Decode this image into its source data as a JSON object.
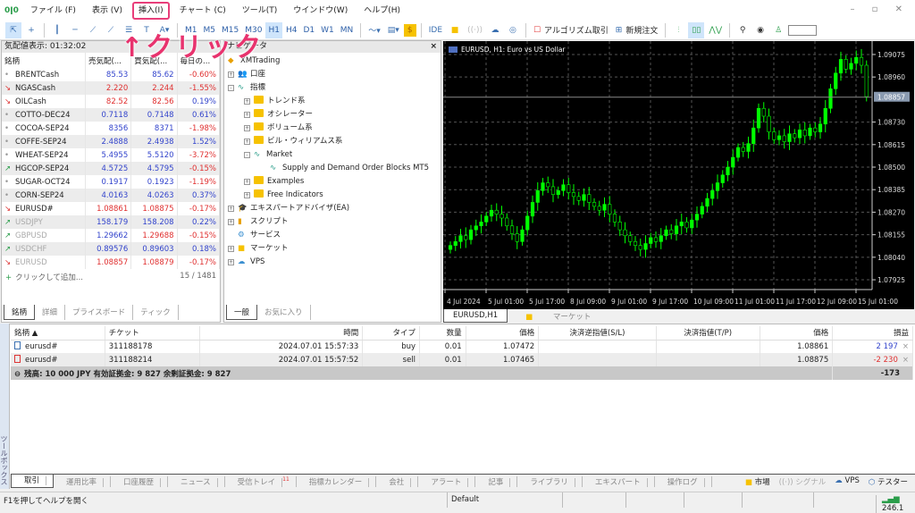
{
  "menu": {
    "items": [
      "ファイル (F)",
      "表示 (V)",
      "挿入(I)",
      "チャート (C)",
      "ツール(T)",
      "ウインドウ(W)",
      "ヘルプ(H)"
    ],
    "window_controls": "– ▫ ✕"
  },
  "toolbar": {
    "timeframes": [
      "M1",
      "M5",
      "M15",
      "M30",
      "H1",
      "H4",
      "D1",
      "W1",
      "MN"
    ],
    "active_timeframe": "H1",
    "ide": "IDE",
    "algo_trading": "アルゴリズム取引",
    "new_order": "新規注文"
  },
  "annotation": "↑クリック",
  "market_watch": {
    "title": "気配値表示: 01:32:02",
    "columns": [
      "銘柄",
      "売気配(...",
      "買気配(...",
      "毎日の..."
    ],
    "rows": [
      {
        "dir": "dot",
        "symbol": "BRENTCash",
        "bid": "85.53",
        "ask": "85.62",
        "change": "-0.60%",
        "bc": "blue",
        "ac": "blue",
        "cc": "red",
        "dim": false
      },
      {
        "dir": "down",
        "symbol": "NGASCash",
        "bid": "2.220",
        "ask": "2.244",
        "change": "-1.55%",
        "bc": "red",
        "ac": "red",
        "cc": "red",
        "dim": false
      },
      {
        "dir": "down",
        "symbol": "OILCash",
        "bid": "82.52",
        "ask": "82.56",
        "change": "0.19%",
        "bc": "red",
        "ac": "red",
        "cc": "blue",
        "dim": false
      },
      {
        "dir": "dot",
        "symbol": "COTTO-DEC24",
        "bid": "0.7118",
        "ask": "0.7148",
        "change": "0.61%",
        "bc": "blue",
        "ac": "blue",
        "cc": "blue",
        "dim": false
      },
      {
        "dir": "dot",
        "symbol": "COCOA-SEP24",
        "bid": "8356",
        "ask": "8371",
        "change": "-1.98%",
        "bc": "blue",
        "ac": "blue",
        "cc": "red",
        "dim": false
      },
      {
        "dir": "dot",
        "symbol": "COFFE-SEP24",
        "bid": "2.4888",
        "ask": "2.4938",
        "change": "1.52%",
        "bc": "blue",
        "ac": "blue",
        "cc": "blue",
        "dim": false
      },
      {
        "dir": "dot",
        "symbol": "WHEAT-SEP24",
        "bid": "5.4955",
        "ask": "5.5120",
        "change": "-3.72%",
        "bc": "blue",
        "ac": "blue",
        "cc": "red",
        "dim": false
      },
      {
        "dir": "up",
        "symbol": "HGCOP-SEP24",
        "bid": "4.5725",
        "ask": "4.5795",
        "change": "-0.15%",
        "bc": "blue",
        "ac": "blue",
        "cc": "red",
        "dim": false
      },
      {
        "dir": "dot",
        "symbol": "SUGAR-OCT24",
        "bid": "0.1917",
        "ask": "0.1923",
        "change": "-1.19%",
        "bc": "blue",
        "ac": "blue",
        "cc": "red",
        "dim": false
      },
      {
        "dir": "dot",
        "symbol": "CORN-SEP24",
        "bid": "4.0163",
        "ask": "4.0263",
        "change": "0.37%",
        "bc": "blue",
        "ac": "blue",
        "cc": "blue",
        "dim": false
      },
      {
        "dir": "down",
        "symbol": "EURUSD#",
        "bid": "1.08861",
        "ask": "1.08875",
        "change": "-0.17%",
        "bc": "red",
        "ac": "red",
        "cc": "red",
        "dim": false
      },
      {
        "dir": "up",
        "symbol": "USDJPY",
        "bid": "158.179",
        "ask": "158.208",
        "change": "0.22%",
        "bc": "blue",
        "ac": "blue",
        "cc": "blue",
        "dim": true
      },
      {
        "dir": "up",
        "symbol": "GBPUSD",
        "bid": "1.29662",
        "ask": "1.29688",
        "change": "-0.15%",
        "bc": "blue",
        "ac": "red",
        "cc": "red",
        "dim": true
      },
      {
        "dir": "up",
        "symbol": "USDCHF",
        "bid": "0.89576",
        "ask": "0.89603",
        "change": "0.18%",
        "bc": "blue",
        "ac": "blue",
        "cc": "blue",
        "dim": true
      },
      {
        "dir": "down",
        "symbol": "EURUSD",
        "bid": "1.08857",
        "ask": "1.08879",
        "change": "-0.17%",
        "bc": "red",
        "ac": "red",
        "cc": "red",
        "dim": true
      }
    ],
    "add_label": "クリックして追加...",
    "count": "15 / 1481",
    "tabs": [
      "銘柄",
      "詳細",
      "プライスボード",
      "ティック"
    ]
  },
  "navigator": {
    "title": "ナビゲータ",
    "items": [
      {
        "label": "XMTrading",
        "level": 0,
        "icon": "broker"
      },
      {
        "label": "口座",
        "level": 0,
        "icon": "accounts",
        "pm": "+"
      },
      {
        "label": "指標",
        "level": 0,
        "icon": "indicator",
        "pm": "-"
      },
      {
        "label": "トレンド系",
        "level": 1,
        "icon": "folder",
        "pm": "+"
      },
      {
        "label": "オシレーター",
        "level": 1,
        "icon": "folder",
        "pm": "+"
      },
      {
        "label": "ボリューム系",
        "level": 1,
        "icon": "folder",
        "pm": "+"
      },
      {
        "label": "ビル・ウィリアムス系",
        "level": 1,
        "icon": "folder",
        "pm": "+"
      },
      {
        "label": "Market",
        "level": 1,
        "icon": "indicator",
        "pm": "-"
      },
      {
        "label": "Supply and Demand Order Blocks MT5",
        "level": 2,
        "icon": "indicator"
      },
      {
        "label": "Examples",
        "level": 1,
        "icon": "folder",
        "pm": "+"
      },
      {
        "label": "Free Indicators",
        "level": 1,
        "icon": "folder",
        "pm": "+"
      },
      {
        "label": "エキスパートアドバイザ(EA)",
        "level": 0,
        "icon": "expert",
        "pm": "+"
      },
      {
        "label": "スクリプト",
        "level": 0,
        "icon": "script",
        "pm": "+"
      },
      {
        "label": "サービス",
        "level": 0,
        "icon": "service"
      },
      {
        "label": "マーケット",
        "level": 0,
        "icon": "market",
        "pm": "+"
      },
      {
        "label": "VPS",
        "level": 0,
        "icon": "vps",
        "pm": "+"
      }
    ],
    "tabs": [
      "一般",
      "お気に入り"
    ]
  },
  "chart_tabs": [
    "EURUSD,H1",
    "マーケット"
  ],
  "chart_data": {
    "type": "candlestick",
    "title": "EURUSD, H1:  Euro vs US Dollar",
    "bar_colors": {
      "up": "#00ff00",
      "down": "#000000",
      "wick": "#00ff00"
    },
    "yticks": [
      "1.09075",
      "1.08960",
      "1.08730",
      "1.08615",
      "1.08500",
      "1.08385",
      "1.08270",
      "1.08155",
      "1.08040",
      "1.07925"
    ],
    "ylim": [
      1.07875,
      1.09125
    ],
    "current_price": "1.08857",
    "xticks": [
      "4 Jul 2024",
      "5 Jul 01:00",
      "5 Jul 17:00",
      "8 Jul 09:00",
      "9 Jul 01:00",
      "9 Jul 17:00",
      "10 Jul 09:00",
      "11 Jul 01:00",
      "11 Jul 17:00",
      "12 Jul 09:00",
      "15 Jul 01:00"
    ],
    "grid": true,
    "closes": [
      1.081,
      1.0812,
      1.0815,
      1.0813,
      1.0818,
      1.082,
      1.0822,
      1.0825,
      1.0828,
      1.0826,
      1.0824,
      1.082,
      1.0816,
      1.0812,
      1.0818,
      1.0825,
      1.0832,
      1.0838,
      1.0842,
      1.084,
      1.0836,
      1.0838,
      1.0841,
      1.0837,
      1.0835,
      1.0833,
      1.0836,
      1.0832,
      1.083,
      1.0828,
      1.0831,
      1.0826,
      1.0822,
      1.0818,
      1.0815,
      1.0812,
      1.081,
      1.0808,
      1.0811,
      1.0814,
      1.0812,
      1.0815,
      1.0818,
      1.0816,
      1.082,
      1.0822,
      1.0819,
      1.0823,
      1.0826,
      1.083,
      1.0834,
      1.0838,
      1.0842,
      1.0846,
      1.085,
      1.0855,
      1.086,
      1.0858,
      1.0862,
      1.087,
      1.088,
      1.0876,
      1.0868,
      1.0864,
      1.0866,
      1.0863,
      1.0867,
      1.0865,
      1.0869,
      1.0866,
      1.087,
      1.0868,
      1.0872,
      1.088,
      1.089,
      1.0898,
      1.0905,
      1.09,
      1.0903,
      1.0906,
      1.0902,
      1.0886
    ]
  },
  "toolbox": {
    "side_label": "ツールボックス",
    "columns": [
      "銘柄 ▲",
      "チケット",
      "時間",
      "タイプ",
      "数量",
      "価格",
      "決済逆指値(S/L)",
      "決済指値(T/P)",
      "価格",
      "損益"
    ],
    "rows": [
      {
        "symbol": "eurusd#",
        "ticket": "311188178",
        "time": "2024.07.01 15:57:33",
        "type": "buy",
        "volume": "0.01",
        "price": "1.07472",
        "sl": "",
        "tp": "",
        "cur": "1.08861",
        "profit": "2 197",
        "pc": "blue"
      },
      {
        "symbol": "eurusd#",
        "ticket": "311188214",
        "time": "2024.07.01 15:57:52",
        "type": "sell",
        "volume": "0.01",
        "price": "1.07465",
        "sl": "",
        "tp": "",
        "cur": "1.08875",
        "profit": "-2 230",
        "pc": "red"
      }
    ],
    "summary": "残高: 10 000 JPY  有効証拠金: 9 827  余剰証拠金: 9 827",
    "summary_profit": "-173",
    "tabs": [
      "取引",
      "運用比率",
      "口座履歴",
      "ニュース",
      "受信トレイ",
      "指標カレンダー",
      "会社",
      "アラート",
      "記事",
      "ライブラリ",
      "エキスパート",
      "操作ログ"
    ],
    "inbox_badge": "11",
    "right_tabs": [
      "市場",
      "シグナル",
      "VPS",
      "テスター"
    ]
  },
  "status": {
    "help": "F1を押してヘルプを開く",
    "profile": "Default",
    "ping": "246.1"
  }
}
